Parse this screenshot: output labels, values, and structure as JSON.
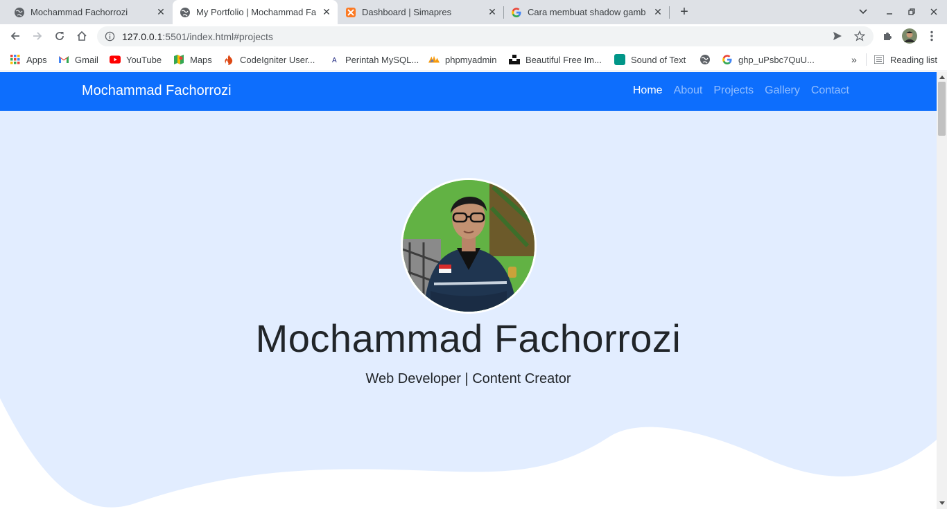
{
  "browser": {
    "tabs": [
      {
        "title": "Mochammad Fachorrozi",
        "icon": "globe-icon",
        "active": false
      },
      {
        "title": "My Portfolio | Mochammad Fa",
        "icon": "globe-icon",
        "active": true
      },
      {
        "title": "Dashboard | Simapres",
        "icon": "xampp-icon",
        "active": false
      },
      {
        "title": "Cara membuat shadow gamb",
        "icon": "google-icon",
        "active": false
      }
    ],
    "url_host": "127.0.0.1",
    "url_rest": ":5501/index.html#projects",
    "bookmarks": [
      {
        "label": "Apps",
        "icon": "apps-grid-icon"
      },
      {
        "label": "Gmail",
        "icon": "gmail-icon"
      },
      {
        "label": "YouTube",
        "icon": "youtube-icon"
      },
      {
        "label": "Maps",
        "icon": "maps-icon"
      },
      {
        "label": "CodeIgniter User...",
        "icon": "codeigniter-icon"
      },
      {
        "label": "Perintah MySQL...",
        "icon": "mysql-icon"
      },
      {
        "label": "phpmyadmin",
        "icon": "phpmyadmin-icon"
      },
      {
        "label": "Beautiful Free Im...",
        "icon": "unsplash-icon"
      },
      {
        "label": "Sound of Text",
        "icon": "sound-of-text-icon"
      },
      {
        "label": "",
        "icon": "globe-icon"
      },
      {
        "label": "ghp_uPsbc7QuU...",
        "icon": "google-icon"
      }
    ],
    "reading_list": "Reading list",
    "overflow_chevron": "»"
  },
  "site": {
    "brand": "Mochammad Fachorrozi",
    "nav": [
      {
        "label": "Home",
        "active": true
      },
      {
        "label": "About",
        "active": false
      },
      {
        "label": "Projects",
        "active": false
      },
      {
        "label": "Gallery",
        "active": false
      },
      {
        "label": "Contact",
        "active": false
      }
    ],
    "hero": {
      "name": "Mochammad Fachorrozi",
      "subtitle": "Web Developer | Content Creator"
    }
  },
  "colors": {
    "navbar": "#0d6efd",
    "hero_bg": "#e2edff",
    "nav_active": "#ffffff",
    "nav_inactive": "rgba(255,255,255,0.55)"
  }
}
